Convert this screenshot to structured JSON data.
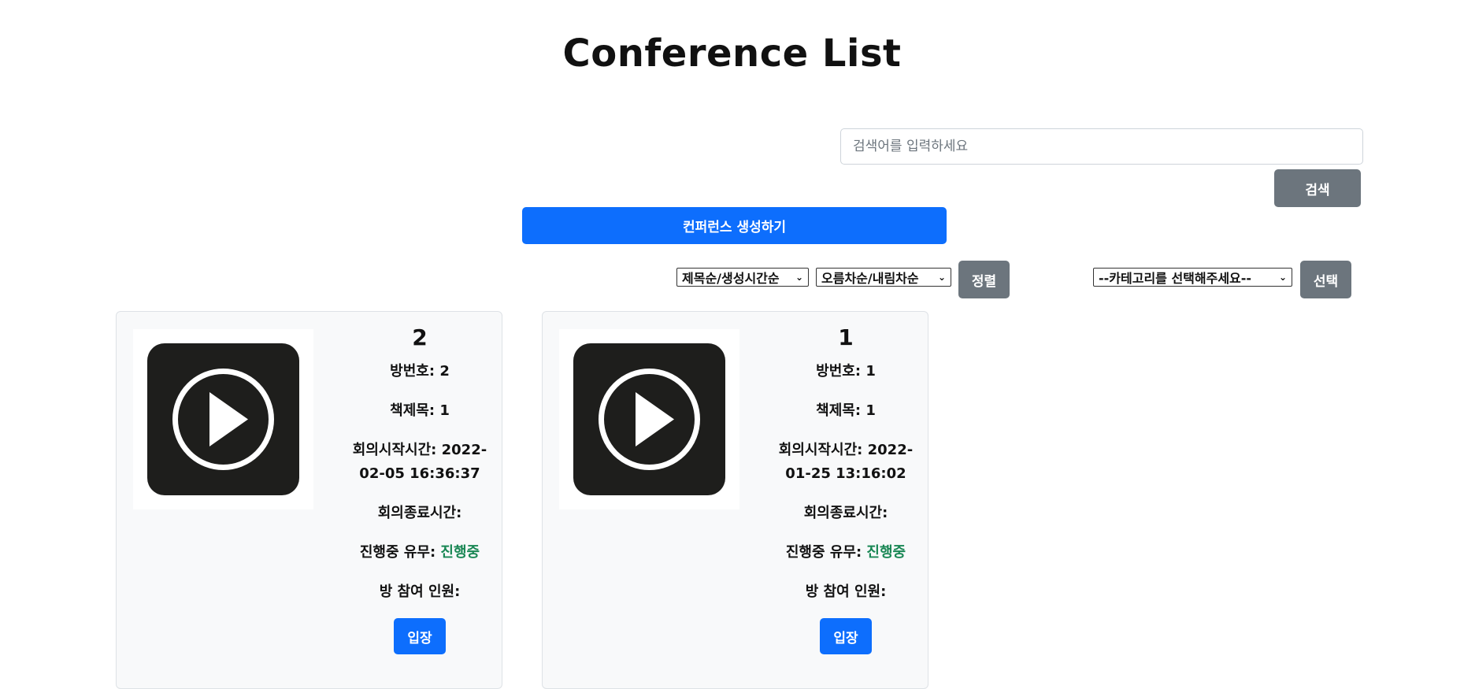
{
  "page": {
    "title": "Conference List"
  },
  "search": {
    "placeholder": "검색어를 입력하세요",
    "button": "검색"
  },
  "create_button": "컨퍼런스 생성하기",
  "filters": {
    "sort_field": "제목순/생성시간순",
    "sort_order": "오름차순/내림차순",
    "sort_button": "정렬",
    "category": "--카테고리를 선택해주세요--",
    "category_button": "선택"
  },
  "labels": {
    "room_no": "방번호:",
    "book_title": "책제목:",
    "start_time": "회의시작시간:",
    "end_time": "회의종료시간:",
    "ongoing": "진행중 유무:",
    "participants": "방 참여 인원:",
    "enter": "입장"
  },
  "conferences": [
    {
      "title": "2",
      "room_no": "2",
      "book_title": "1",
      "start_a": "2022-",
      "start_b": "02-05 16:36:37",
      "end": "",
      "status": "진행중",
      "participants": ""
    },
    {
      "title": "1",
      "room_no": "1",
      "book_title": "1",
      "start_a": "2022-",
      "start_b": "01-25 13:16:02",
      "end": "",
      "status": "진행중",
      "participants": ""
    }
  ],
  "colors": {
    "primary": "#0d6efd",
    "secondary": "#6c757d",
    "status": "#198754",
    "card_bg": "#f8f9fa"
  }
}
